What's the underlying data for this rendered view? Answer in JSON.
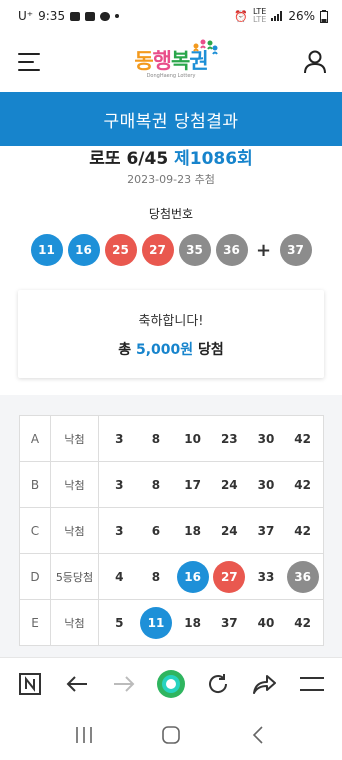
{
  "status_bar": {
    "carrier": "U⁺",
    "time": "9:35",
    "network_top": "LTE",
    "network_bottom": "LTE",
    "battery": "26%"
  },
  "header": {
    "logo_text": "동행복권",
    "logo_sub": "DongHaeng Lottery",
    "menu_icon": "hamburger-icon",
    "user_icon": "user-icon"
  },
  "page_title": "구매복권 당첨결과",
  "draw": {
    "game": "로또 6/45",
    "round": "제1086회",
    "date": "2023-09-23 추첨",
    "winning_label": "당첨번호",
    "numbers": [
      "11",
      "16",
      "25",
      "27",
      "35",
      "36"
    ],
    "plus": "+",
    "bonus": "37"
  },
  "result": {
    "congrats": "축하합니다!",
    "prefix": "총",
    "amount": "5,000원",
    "suffix": "당첨"
  },
  "ticket_rows": [
    {
      "letter": "A",
      "result": "낙첨",
      "numbers": [
        "3",
        "8",
        "10",
        "23",
        "30",
        "42"
      ]
    },
    {
      "letter": "B",
      "result": "낙첨",
      "numbers": [
        "3",
        "8",
        "17",
        "24",
        "30",
        "42"
      ]
    },
    {
      "letter": "C",
      "result": "낙첨",
      "numbers": [
        "3",
        "6",
        "18",
        "24",
        "37",
        "42"
      ]
    },
    {
      "letter": "D",
      "result": "5등당첨",
      "numbers": [
        "4",
        "8",
        "16",
        "27",
        "33",
        "36"
      ]
    },
    {
      "letter": "E",
      "result": "낙첨",
      "numbers": [
        "5",
        "11",
        "18",
        "37",
        "40",
        "42"
      ]
    }
  ],
  "colors": {
    "brand_blue": "#1784cc",
    "ball_blue": "#1e90d8",
    "ball_red": "#e9584f",
    "ball_gray": "#8c8c8c",
    "ball_green": "#2fb55f"
  },
  "browser_bar": [
    "n-icon",
    "back-arrow-icon",
    "forward-arrow-icon",
    "home-dot-icon",
    "refresh-icon",
    "share-icon",
    "menu-lines-icon"
  ],
  "nav_bar": [
    "recent-apps-icon",
    "home-icon",
    "back-icon"
  ]
}
